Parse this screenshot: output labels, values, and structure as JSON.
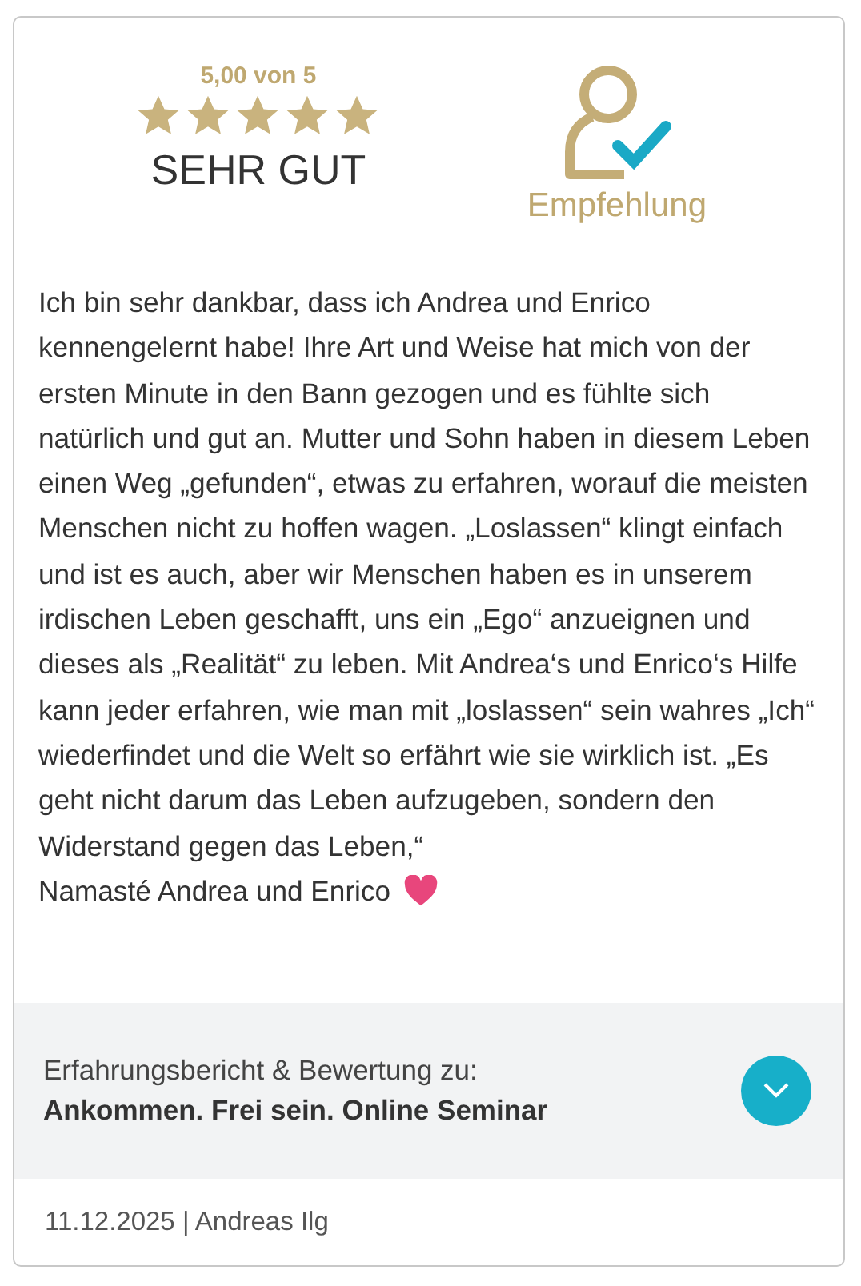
{
  "rating": {
    "score": "5,00 von 5",
    "stars": 5,
    "verdict": "SEHR GUT"
  },
  "recommendation": {
    "label": "Empfehlung"
  },
  "review": {
    "paragraphs": [
      "Ich bin sehr dankbar, dass ich Andrea und Enrico kennengelernt habe! Ihre Art und Weise hat mich von der ersten Minute in den Bann gezogen und es fühlte sich natürlich und gut an. Mutter und Sohn haben in diesem Leben einen Weg „gefunden“, etwas zu erfahren, worauf die meisten Menschen nicht zu hoffen wagen. „Loslassen“ klingt einfach und ist es auch, aber wir Menschen haben es in unserem irdischen Leben geschafft, uns ein „Ego“ anzueignen und dieses als „Realität“ zu leben. Mit Andrea‘s und Enrico‘s Hilfe kann jeder erfahren, wie man mit „loslassen“ sein wahres „Ich“ wiederfindet und die Welt so erfährt wie sie wirklich ist. „Es geht nicht darum das Leben aufzugeben, sondern den Widerstand gegen das Leben,“",
      "Namasté Andrea und Enrico"
    ]
  },
  "product": {
    "caption": "Erfahrungsbericht & Bewertung zu:",
    "name": "Ankommen. Frei sein. Online Seminar"
  },
  "footer": {
    "meta": "11.12.2025 | Andreas Ilg"
  }
}
